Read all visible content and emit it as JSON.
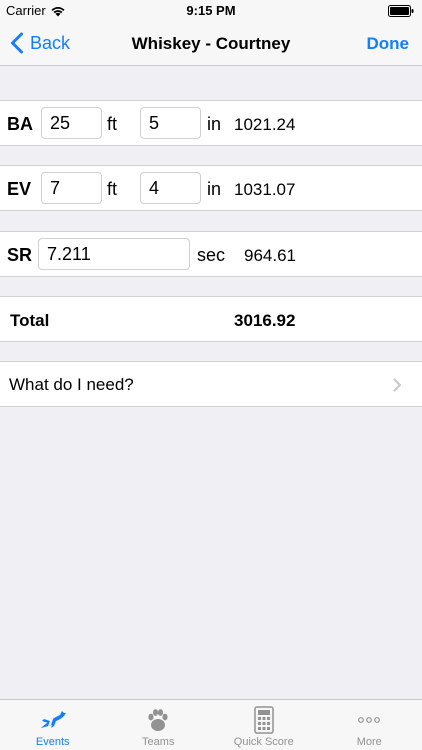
{
  "status": {
    "carrier": "Carrier",
    "time": "9:15 PM"
  },
  "nav": {
    "back_label": "Back",
    "title": "Whiskey - Courtney",
    "done_label": "Done"
  },
  "rows": {
    "ba": {
      "label": "BA",
      "feet": "25",
      "feet_unit": "ft",
      "inches": "5",
      "inches_unit": "in",
      "score": "1021.24"
    },
    "ev": {
      "label": "EV",
      "feet": "7",
      "feet_unit": "ft",
      "inches": "4",
      "inches_unit": "in",
      "score": "1031.07"
    },
    "sr": {
      "label": "SR",
      "time": "7.211",
      "time_unit": "sec",
      "score": "964.61"
    }
  },
  "total": {
    "label": "Total",
    "value": "3016.92"
  },
  "need": {
    "label": "What do I need?"
  },
  "tabs": [
    {
      "label": "Events",
      "icon": "jumping-dog-icon",
      "active": true
    },
    {
      "label": "Teams",
      "icon": "paw-icon",
      "active": false
    },
    {
      "label": "Quick Score",
      "icon": "calculator-icon",
      "active": false
    },
    {
      "label": "More",
      "icon": "more-dots-icon",
      "active": false
    }
  ],
  "colors": {
    "accent": "#147efb",
    "background": "#efeff4",
    "inactive_tab": "#929292"
  }
}
